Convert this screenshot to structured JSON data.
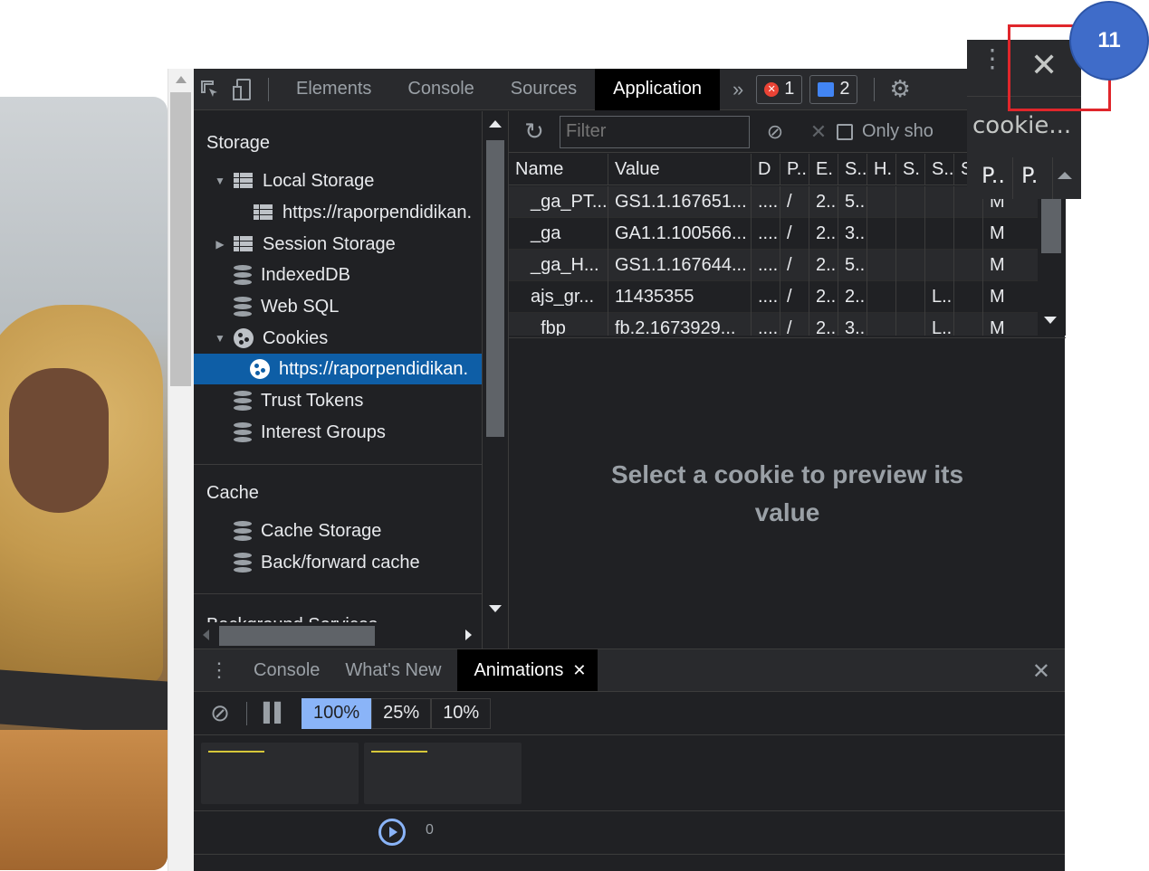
{
  "step": {
    "number": "11"
  },
  "toolbar": {
    "tabs": [
      {
        "label": "Elements",
        "active": false
      },
      {
        "label": "Console",
        "active": false
      },
      {
        "label": "Sources",
        "active": false
      },
      {
        "label": "Application",
        "active": true
      }
    ],
    "more_tabs": "»",
    "errors_count": "1",
    "messages_count": "2"
  },
  "overlay": {
    "panel_title": "cookie...",
    "col1": "P..",
    "col2": "P."
  },
  "sidebar": {
    "storage_title": "Storage",
    "cache_title": "Cache",
    "background_title": "Background Services",
    "items": [
      {
        "label": "Local Storage"
      },
      {
        "label": "https://raporpendidikan."
      },
      {
        "label": "Session Storage"
      },
      {
        "label": "IndexedDB"
      },
      {
        "label": "Web SQL"
      },
      {
        "label": "Cookies"
      },
      {
        "label": "https://raporpendidikan."
      },
      {
        "label": "Trust Tokens"
      },
      {
        "label": "Interest Groups"
      }
    ],
    "cache_items": [
      {
        "label": "Cache Storage"
      },
      {
        "label": "Back/forward cache"
      }
    ]
  },
  "cookies": {
    "filter_placeholder": "Filter",
    "only_label": "Only sho",
    "columns": [
      "Name",
      "Value",
      "D",
      "P..",
      "E.",
      "S..",
      "H.",
      "S.",
      "S..",
      "S"
    ],
    "rows": [
      [
        "_ga_PT...",
        "GS1.1.167651...",
        "....",
        "/",
        "2...",
        "5...",
        "",
        "",
        "",
        "",
        "M"
      ],
      [
        "_ga",
        "GA1.1.100566...",
        "....",
        "/",
        "2...",
        "3...",
        "",
        "",
        "",
        "",
        "M"
      ],
      [
        "_ga_H...",
        "GS1.1.167644...",
        "....",
        "/",
        "2...",
        "5...",
        "",
        "",
        "",
        "",
        "M"
      ],
      [
        "ajs_gr...",
        "11435355",
        "....",
        "/",
        "2...",
        "2...",
        "",
        "",
        "L...",
        "",
        "M"
      ],
      [
        "_fbp",
        "fb.2.1673929...",
        "....",
        "/",
        "2...",
        "3...",
        "",
        "",
        "L...",
        "",
        "M"
      ]
    ],
    "preview_text": "Select a cookie to preview its value"
  },
  "drawer": {
    "tabs": [
      {
        "label": "Console"
      },
      {
        "label": "What's New"
      },
      {
        "label": "Animations"
      }
    ],
    "speeds": [
      "100%",
      "25%",
      "10%"
    ],
    "timeline_zero": "0"
  },
  "colors": {
    "accent_selected": "#0e5ea6",
    "highlight": "#e0262b",
    "step_badge": "#3f6cc9",
    "speed_active": "#8ab4f8"
  }
}
